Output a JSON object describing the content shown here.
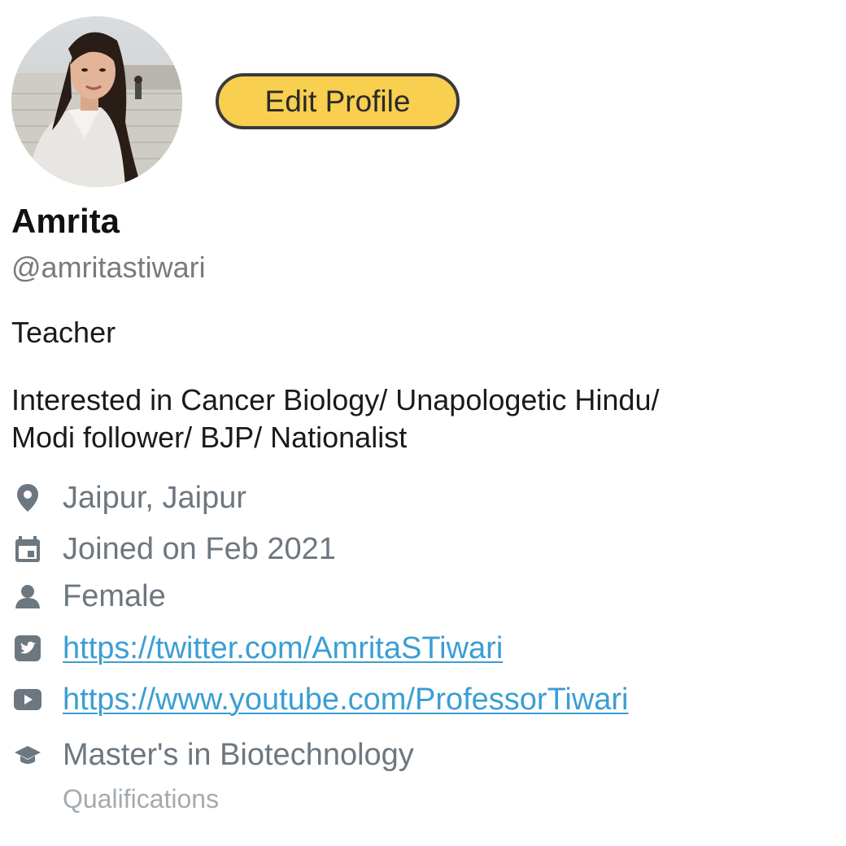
{
  "profile": {
    "edit_label": "Edit Profile",
    "name": "Amrita",
    "handle": "@amritastiwari",
    "title": "Teacher",
    "bio_line1": "Interested in Cancer Biology/ Unapologetic Hindu/",
    "bio_line2": "Modi follower/ BJP/ Nationalist"
  },
  "details": {
    "location": "Jaipur, Jaipur",
    "joined": "Joined on Feb 2021",
    "gender": "Female",
    "twitter": "https://twitter.com/AmritaSTiwari",
    "youtube": "https://www.youtube.com/ProfessorTiwari",
    "qualification": "Master's in Biotechnology",
    "qualification_label": "Qualifications"
  },
  "colors": {
    "button_bg": "#f8cf4f",
    "link": "#3b9ed4",
    "icon": "#6d7780"
  }
}
